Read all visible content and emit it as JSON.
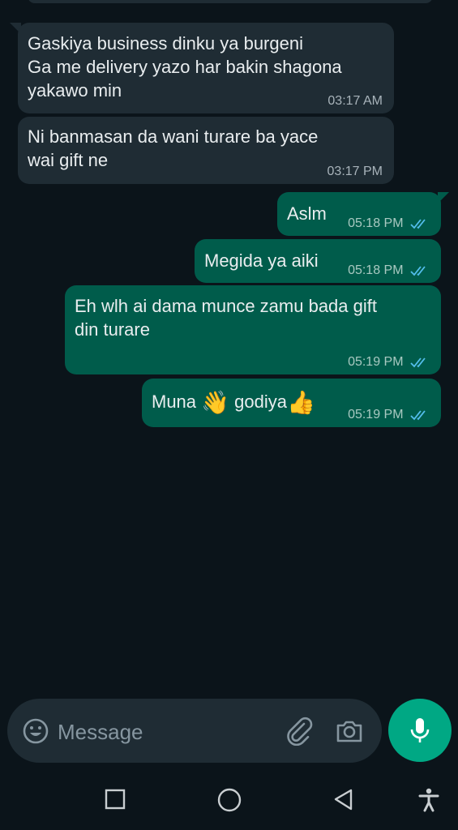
{
  "messages": [
    {
      "direction": "incoming",
      "lines": [
        "Gaskiya business dinku ya burgeni",
        "Ga me delivery yazo har bakin shagona",
        "yakawo min"
      ],
      "time": "03:17 AM"
    },
    {
      "direction": "incoming",
      "lines": [
        "Ni banmasan da wani turare ba yace",
        "wai gift ne"
      ],
      "time": "03:17 PM"
    },
    {
      "direction": "outgoing",
      "text": "Aslm",
      "time": "05:18 PM",
      "status": "read"
    },
    {
      "direction": "outgoing",
      "text": "Megida ya aiki",
      "time": "05:18 PM",
      "status": "read"
    },
    {
      "direction": "outgoing",
      "lines": [
        "Eh wlh ai dama munce zamu bada gift",
        "din turare"
      ],
      "time": "05:19 PM",
      "status": "read"
    },
    {
      "direction": "outgoing",
      "parts": [
        "Muna ",
        "👋",
        " godiya",
        "👍"
      ],
      "time": "05:19 PM",
      "status": "read"
    }
  ],
  "composer": {
    "placeholder": "Message",
    "icons": [
      "emoji-icon",
      "attach-icon",
      "camera-icon",
      "mic-icon"
    ]
  },
  "navigation": [
    "recent-apps-icon",
    "home-icon",
    "back-icon",
    "accessibility-icon"
  ],
  "colors": {
    "background": "#0b141a",
    "incoming_bubble": "#1f2c34",
    "outgoing_bubble": "#005c4b",
    "accent": "#00a884",
    "read_tick": "#53bdeb"
  }
}
